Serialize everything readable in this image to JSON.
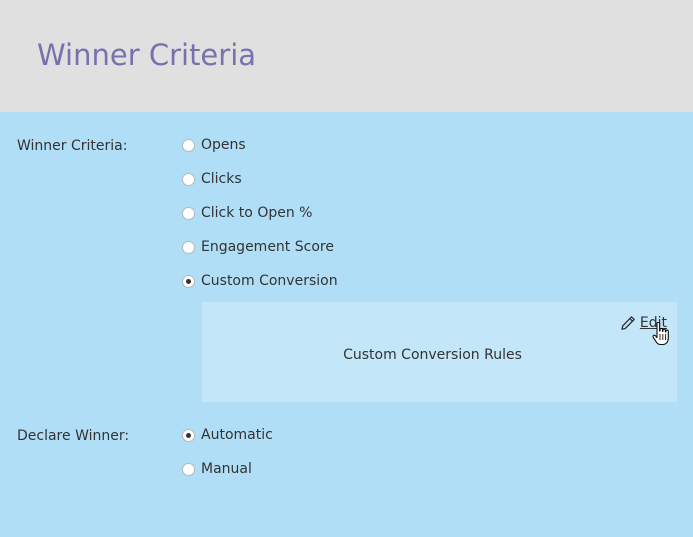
{
  "header": {
    "title": "Winner Criteria"
  },
  "winner_criteria": {
    "label": "Winner Criteria:",
    "options": [
      {
        "label": "Opens",
        "selected": false
      },
      {
        "label": "Clicks",
        "selected": false
      },
      {
        "label": "Click to Open %",
        "selected": false
      },
      {
        "label": "Engagement Score",
        "selected": false
      },
      {
        "label": "Custom Conversion",
        "selected": true
      }
    ],
    "rules_panel": {
      "edit_label": "Edit",
      "edit_icon": "pencil-icon",
      "text": "Custom Conversion Rules"
    }
  },
  "declare_winner": {
    "label": "Declare Winner:",
    "options": [
      {
        "label": "Automatic",
        "selected": true
      },
      {
        "label": "Manual",
        "selected": false
      }
    ]
  },
  "colors": {
    "header_bg": "#e0e0e0",
    "title_color": "#7772ad",
    "body_bg": "#b0def6",
    "panel_bg": "#c4e6f9"
  },
  "cursor": "hand-pointer-icon"
}
